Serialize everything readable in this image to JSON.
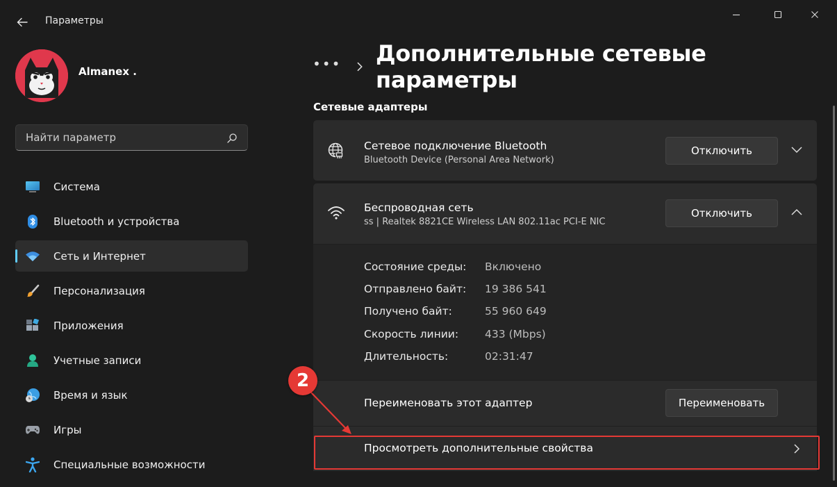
{
  "app": {
    "title": "Параметры"
  },
  "user": {
    "name": "Almanex ."
  },
  "search": {
    "placeholder": "Найти параметр"
  },
  "sidebar": {
    "items": [
      {
        "label": "Система",
        "icon": "system-icon",
        "active": false
      },
      {
        "label": "Bluetooth и устройства",
        "icon": "bluetooth-icon",
        "active": false
      },
      {
        "label": "Сеть и Интернет",
        "icon": "network-icon",
        "active": true
      },
      {
        "label": "Персонализация",
        "icon": "brush-icon",
        "active": false
      },
      {
        "label": "Приложения",
        "icon": "apps-icon",
        "active": false
      },
      {
        "label": "Учетные записи",
        "icon": "accounts-icon",
        "active": false
      },
      {
        "label": "Время и язык",
        "icon": "time-language-icon",
        "active": false
      },
      {
        "label": "Игры",
        "icon": "gamepad-icon",
        "active": false
      },
      {
        "label": "Специальные возможности",
        "icon": "accessibility-icon",
        "active": false
      }
    ]
  },
  "breadcrumb": {
    "more": "•••",
    "title": "Дополнительные сетевые параметры"
  },
  "main": {
    "section_title": "Сетевые адаптеры",
    "adapters": [
      {
        "name": "Сетевое подключение Bluetooth",
        "description": "Bluetooth Device (Personal Area Network)",
        "button": "Отключить",
        "icon": "ethernet-globe-icon",
        "expanded": false
      },
      {
        "name": "Беспроводная сеть",
        "description": "ss | Realtek 8821CE Wireless LAN 802.11ac PCI-E NIC",
        "button": "Отключить",
        "icon": "wifi-icon",
        "expanded": true
      }
    ],
    "properties": [
      {
        "label": "Состояние среды:",
        "value": "Включено"
      },
      {
        "label": "Отправлено байт:",
        "value": "19 386 541"
      },
      {
        "label": "Получено байт:",
        "value": "55 960 649"
      },
      {
        "label": "Скорость линии:",
        "value": "433 (Mbps)"
      },
      {
        "label": "Длительность:",
        "value": "02:31:47"
      }
    ],
    "rename": {
      "label": "Переименовать этот адаптер",
      "button": "Переименовать"
    },
    "view_more": {
      "label": "Просмотреть дополнительные свойства"
    }
  },
  "annotation": {
    "badge": "2",
    "color": "#e53935"
  },
  "colors": {
    "accent": "#60cdff",
    "background": "#1c1c1c",
    "card": "#2b2b2b"
  }
}
